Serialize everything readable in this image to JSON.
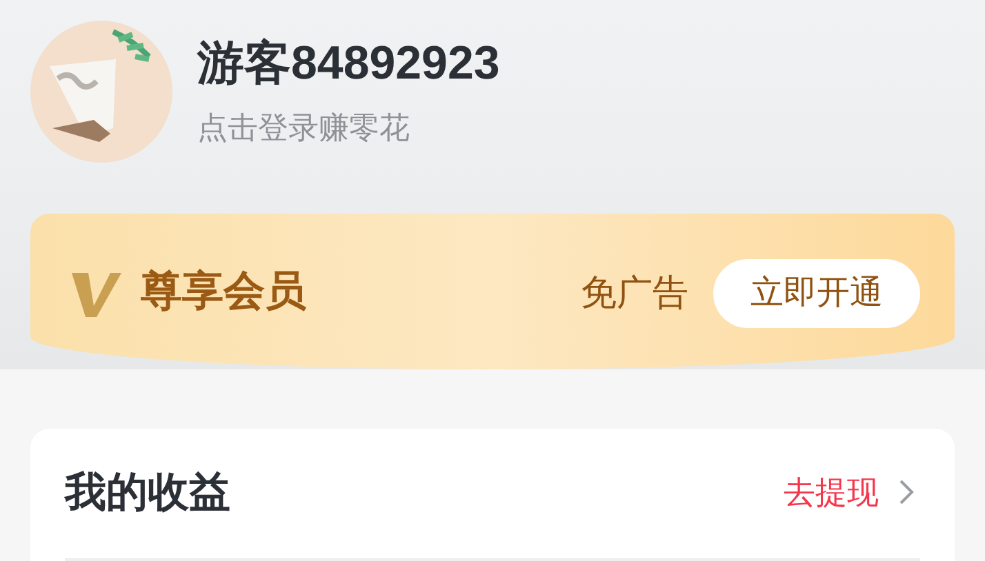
{
  "profile": {
    "username": "游客84892923",
    "subtitle": "点击登录赚零花"
  },
  "vip_banner": {
    "title": "尊享会员",
    "perk": "免广告",
    "button": "立即开通"
  },
  "earnings_card": {
    "title": "我的收益",
    "link": "去提现"
  }
}
